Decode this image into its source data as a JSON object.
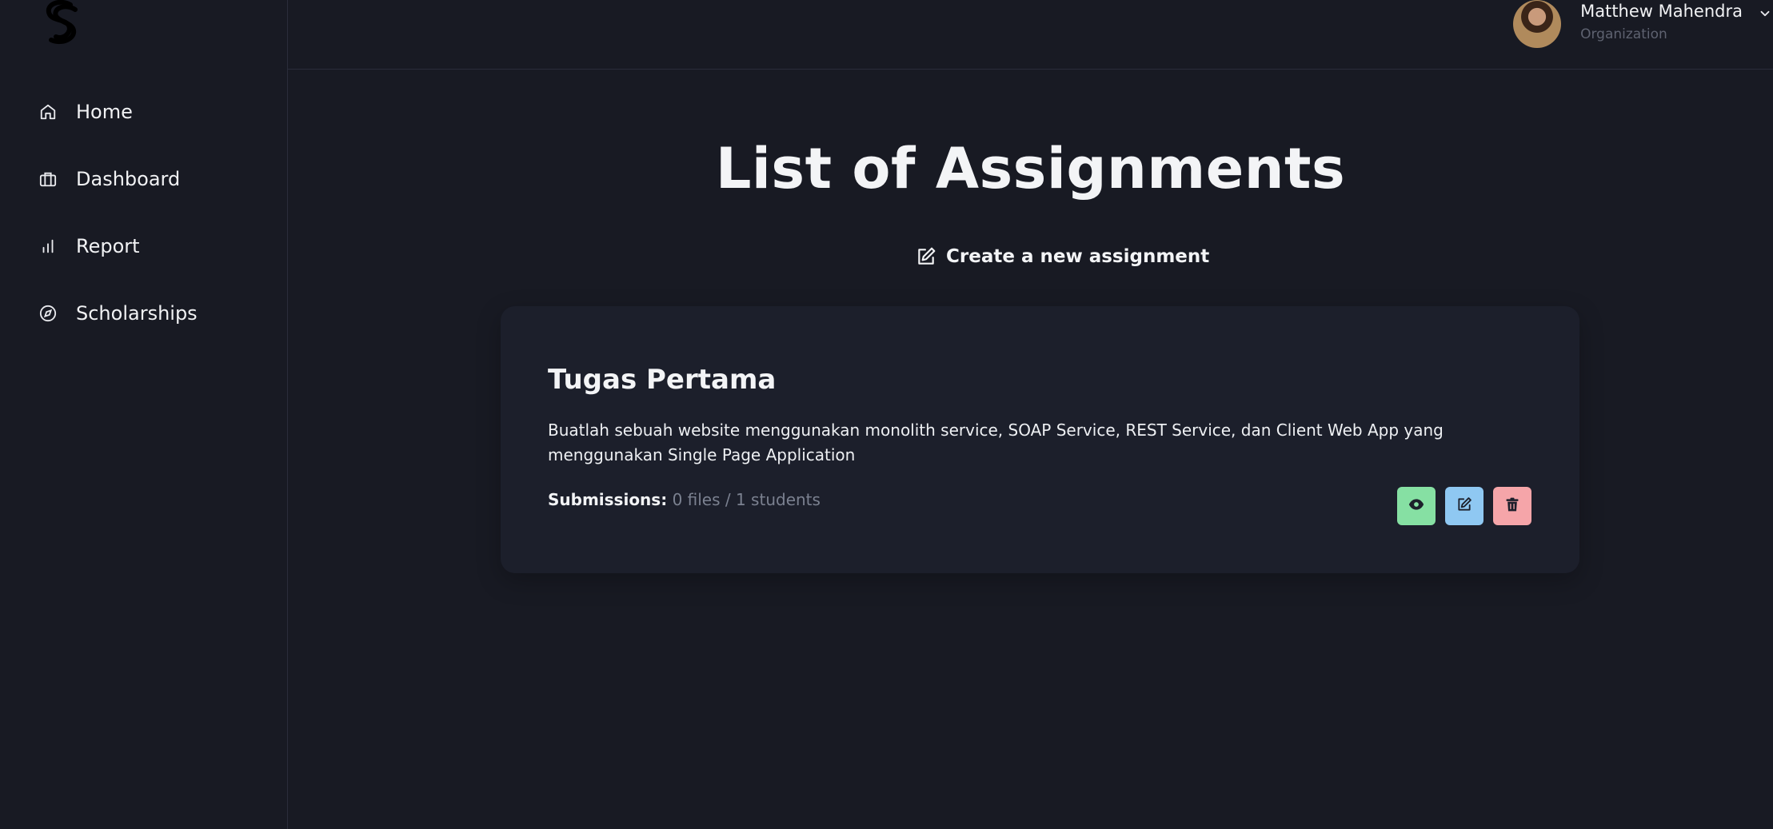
{
  "sidebar": {
    "logo_icon": "brand-s-logo",
    "items": [
      {
        "label": "Home",
        "icon": "home-icon"
      },
      {
        "label": "Dashboard",
        "icon": "briefcase-icon"
      },
      {
        "label": "Report",
        "icon": "bar-chart-icon"
      },
      {
        "label": "Scholarships",
        "icon": "compass-icon"
      }
    ]
  },
  "user": {
    "name": "Matthew Mahendra",
    "role": "Organization"
  },
  "main": {
    "title": "List of Assignments",
    "create_label": "Create a new assignment",
    "assignments": [
      {
        "title": "Tugas Pertama",
        "description": "Buatlah sebuah website menggunakan monolith service, SOAP Service, REST Service, dan Client Web App yang menggunakan Single Page Application",
        "submissions_label": "Submissions:",
        "submissions_value": "0 files / 1 students"
      }
    ]
  },
  "colors": {
    "background": "#181a23",
    "card": "#1c1f2b",
    "view_button": "#86e0a3",
    "edit_button": "#8fc8f2",
    "delete_button": "#f5a5a9"
  }
}
